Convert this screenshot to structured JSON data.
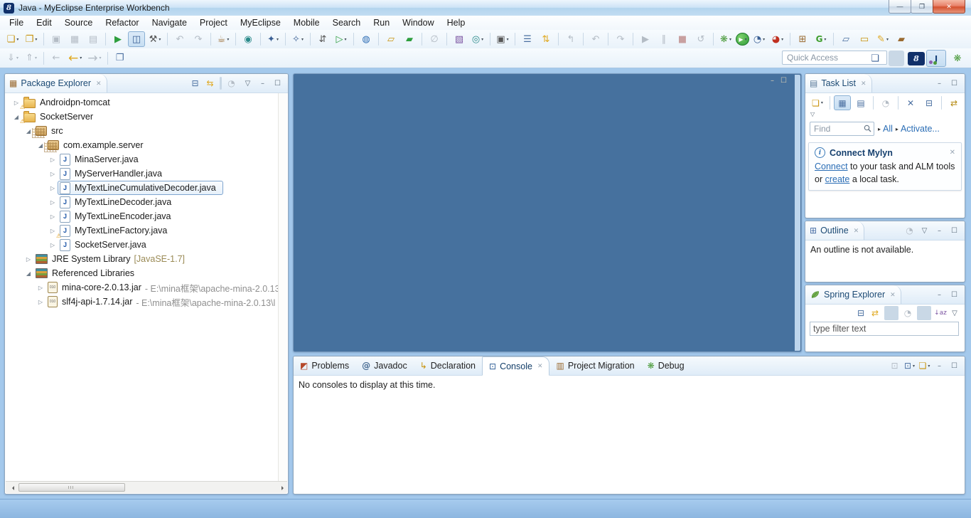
{
  "colors": {
    "titlebar": "#cde3f6",
    "workbench_bg": "#a4c9ec",
    "editor_bg": "#46719e",
    "link": "#2a6db5",
    "tab_text": "#1c4a74",
    "close_button": "#d4512f",
    "suffix_olive": "#9a8a55",
    "suffix_gray": "#8f8f8f"
  },
  "window": {
    "title": "Java - MyEclipse Enterprise Workbench",
    "logo": "8",
    "controls": [
      {
        "name": "minimize-button",
        "g": "—",
        "cls": "win"
      },
      {
        "name": "restore-button",
        "g": "❐",
        "cls": "win"
      },
      {
        "name": "close-button",
        "g": "✕",
        "cls": "close"
      }
    ]
  },
  "menu": {
    "items": [
      {
        "name": "menu-file",
        "label": "File"
      },
      {
        "name": "menu-edit",
        "label": "Edit"
      },
      {
        "name": "menu-source",
        "label": "Source"
      },
      {
        "name": "menu-refactor",
        "label": "Refactor"
      },
      {
        "name": "menu-navigate",
        "label": "Navigate"
      },
      {
        "name": "menu-project",
        "label": "Project"
      },
      {
        "name": "menu-myeclipse",
        "label": "MyEclipse"
      },
      {
        "name": "menu-mobile",
        "label": "Mobile"
      },
      {
        "name": "menu-search",
        "label": "Search"
      },
      {
        "name": "menu-run",
        "label": "Run"
      },
      {
        "name": "menu-window",
        "label": "Window"
      },
      {
        "name": "menu-help",
        "label": "Help"
      }
    ]
  },
  "toolbar1": {
    "items": [
      {
        "name": "new-wizard-icon",
        "g": "❏",
        "cls": "gold dd"
      },
      {
        "name": "new-web-project-icon",
        "g": "❐",
        "cls": "gold dd"
      },
      {
        "cls": "sep",
        "inter": false
      },
      {
        "name": "save-icon",
        "g": "▣",
        "cls": "dis"
      },
      {
        "name": "save-all-icon",
        "g": "▦",
        "cls": "dis"
      },
      {
        "name": "print-icon",
        "g": "▤",
        "cls": "dis"
      },
      {
        "cls": "sep",
        "inter": false
      },
      {
        "name": "run-on-device-icon",
        "g": "▶",
        "cls": "green"
      },
      {
        "name": "deploy-device-icon",
        "g": "◫",
        "cls": "navy press"
      },
      {
        "name": "build-hammer-icon",
        "g": "⚒",
        "cls": "dark dd"
      },
      {
        "cls": "sep",
        "inter": false
      },
      {
        "name": "previous-annotation-icon",
        "g": "↶",
        "cls": "dis"
      },
      {
        "name": "next-annotation-icon",
        "g": "↷",
        "cls": "dis"
      },
      {
        "cls": "sep",
        "inter": false
      },
      {
        "name": "new-javaee-component-icon",
        "g": "☕",
        "cls": "brown dd"
      },
      {
        "cls": "sep",
        "inter": false
      },
      {
        "name": "web20-icon",
        "g": "◉",
        "cls": "teal"
      },
      {
        "cls": "sep",
        "inter": false
      },
      {
        "name": "myeclipse-wizard-icon",
        "g": "✦",
        "cls": "navy dd"
      },
      {
        "cls": "sep",
        "inter": false
      },
      {
        "name": "myeclipse-deploy-wizard-icon",
        "g": "✧",
        "cls": "navy dd"
      },
      {
        "cls": "sep",
        "inter": false
      },
      {
        "name": "jar-sync-icon",
        "g": "⇵",
        "cls": "dark"
      },
      {
        "name": "run-external-tools-icon",
        "g": "▷",
        "cls": "green dd"
      },
      {
        "cls": "sep",
        "inter": false
      },
      {
        "name": "web-browser-icon",
        "g": "◍",
        "cls": "blue"
      },
      {
        "cls": "sep",
        "inter": false
      },
      {
        "name": "open-folder-icon",
        "g": "▱",
        "cls": "gold"
      },
      {
        "name": "sync-folder-icon",
        "g": "▰",
        "cls": "green"
      },
      {
        "cls": "sep",
        "inter": false
      },
      {
        "name": "toggle-disabled-icon",
        "g": "∅",
        "cls": "dis"
      },
      {
        "cls": "sep",
        "inter": false
      },
      {
        "name": "new-report-icon",
        "g": "▧",
        "cls": "purple"
      },
      {
        "name": "web-service-icon",
        "g": "◎",
        "cls": "teal dd"
      },
      {
        "cls": "sep",
        "inter": false
      },
      {
        "name": "screen-capture-icon",
        "g": "▣",
        "cls": "dark dd"
      },
      {
        "cls": "sep",
        "inter": false
      },
      {
        "name": "show-tasks-icon",
        "g": "☰",
        "cls": "steel"
      },
      {
        "name": "toggle-sort-icon",
        "g": "⇅",
        "cls": "goldarrow"
      },
      {
        "cls": "sep",
        "inter": false
      },
      {
        "name": "step-return-icon",
        "g": "↰",
        "cls": "dis"
      },
      {
        "cls": "sep",
        "inter": false
      },
      {
        "name": "undo-icon",
        "g": "↶",
        "cls": "dis"
      },
      {
        "cls": "sep",
        "inter": false
      },
      {
        "name": "redo-icon",
        "g": "↷",
        "cls": "dis"
      },
      {
        "cls": "sep",
        "inter": false
      },
      {
        "name": "resume-icon",
        "g": "▶",
        "cls": "dis"
      },
      {
        "name": "pause-icon",
        "g": "∥",
        "cls": "dis"
      },
      {
        "name": "terminate-icon",
        "g": "■",
        "cls": "disred"
      },
      {
        "name": "relaunch-icon",
        "g": "↺",
        "cls": "dis"
      },
      {
        "cls": "sep",
        "inter": false
      },
      {
        "name": "debug-icon",
        "g": "❋",
        "cls": "green2 dd"
      },
      {
        "name": "run-icon",
        "g": "▶",
        "cls": "circ dd"
      },
      {
        "name": "run-history-icon",
        "g": "◔",
        "cls": "navy dd"
      },
      {
        "name": "profile-icon",
        "g": "◕",
        "cls": "red dd"
      },
      {
        "cls": "sep",
        "inter": false
      },
      {
        "name": "junit-icon",
        "g": "⊞",
        "cls": "brown"
      },
      {
        "name": "generate-icon",
        "g": "G",
        "cls": "greenG dd"
      },
      {
        "cls": "sep",
        "inter": false
      },
      {
        "name": "open-resource-icon",
        "g": "▱",
        "cls": "steel"
      },
      {
        "name": "clipboard-folder-icon",
        "g": "▭",
        "cls": "gold"
      },
      {
        "name": "marker-pen-icon",
        "g": "✎",
        "cls": "goldarrow dd"
      },
      {
        "name": "open-type-icon",
        "g": "▰",
        "cls": "brown"
      }
    ]
  },
  "toolbar2": {
    "items": [
      {
        "name": "commit-icon",
        "g": "⇓",
        "cls": "dis dd"
      },
      {
        "name": "update-icon",
        "g": "⇑",
        "cls": "dis dd"
      },
      {
        "cls": "sep",
        "inter": false
      },
      {
        "name": "last-edit-location-icon",
        "g": "←",
        "cls": "dis"
      },
      {
        "name": "back-icon",
        "g": "←",
        "cls": "goldarrow big dd"
      },
      {
        "name": "forward-icon",
        "g": "→",
        "cls": "dis big dd"
      },
      {
        "cls": "sep",
        "inter": false
      },
      {
        "name": "link-with-editor-icon",
        "g": "❐",
        "cls": "steel"
      }
    ]
  },
  "quick_access": {
    "placeholder": "Quick Access"
  },
  "perspectives": {
    "items": [
      {
        "name": "open-perspective-icon",
        "g": "❏",
        "cls": "navy"
      },
      {
        "cls": "sep",
        "inter": false
      },
      {
        "name": "myeclipse-perspective-icon",
        "g": "8",
        "cls": "melogo"
      },
      {
        "name": "java-perspective-icon",
        "g": "J",
        "cls": "javapersp press"
      },
      {
        "name": "debug-perspective-icon",
        "g": "❋",
        "cls": "green2"
      }
    ]
  },
  "package_explorer": {
    "tab": {
      "label": "Package Explorer",
      "g": "▦",
      "close": "✕"
    },
    "toolbar": [
      {
        "name": "collapse-all-icon",
        "g": "⊟",
        "cls": "steel"
      },
      {
        "name": "link-with-editor-icon",
        "g": "⇆",
        "cls": "goldarrow"
      },
      {
        "cls": "sep",
        "inter": false
      },
      {
        "name": "focus-on-task-icon",
        "g": "◔",
        "cls": "dis"
      },
      {
        "cls": "spacer",
        "inter": false
      },
      {
        "name": "view-menu-icon",
        "g": "▽",
        "cls": "mini"
      },
      {
        "name": "minimize-icon",
        "g": "–",
        "cls": "mini"
      },
      {
        "name": "maximize-icon",
        "g": "☐",
        "cls": "mini"
      }
    ],
    "tree": [
      {
        "cls": "lv0",
        "arrow": "▷",
        "icon": "tomcat-project-icon",
        "icls": "i-folder warn",
        "label": "Androidpn-tomcat"
      },
      {
        "cls": "lv0",
        "arrow": "◢",
        "icon": "java-project-icon",
        "icls": "i-folder warn",
        "label": "SocketServer"
      },
      {
        "cls": "lv1",
        "arrow": "◢",
        "icon": "source-folder-icon",
        "icls": "i-src warn",
        "label": "src"
      },
      {
        "cls": "lv2",
        "arrow": "◢",
        "icon": "package-icon",
        "icls": "i-pkg warn",
        "label": "com.example.server"
      },
      {
        "cls": "lv3",
        "arrow": "▷",
        "icon": "java-file-icon",
        "icls": "i-java",
        "label": "MinaServer.java"
      },
      {
        "cls": "lv3",
        "arrow": "▷",
        "icon": "java-file-icon",
        "icls": "i-java",
        "label": "MyServerHandler.java"
      },
      {
        "cls": "lv3 sel",
        "arrow": "▷",
        "icon": "java-file-icon",
        "icls": "i-java",
        "label": "MyTextLineCumulativeDecoder.java"
      },
      {
        "cls": "lv3",
        "arrow": "▷",
        "icon": "java-file-icon",
        "icls": "i-java",
        "label": "MyTextLineDecoder.java"
      },
      {
        "cls": "lv3",
        "arrow": "▷",
        "icon": "java-file-icon",
        "icls": "i-java",
        "label": "MyTextLineEncoder.java"
      },
      {
        "cls": "lv3",
        "arrow": "▷",
        "icon": "java-file-icon",
        "icls": "i-java warn",
        "label": "MyTextLineFactory.java"
      },
      {
        "cls": "lv3",
        "arrow": "▷",
        "icon": "java-file-icon",
        "icls": "i-java",
        "label": "SocketServer.java"
      },
      {
        "cls": "lv1",
        "arrow": "▷",
        "icon": "library-icon",
        "icls": "i-lib",
        "label": "JRE System Library",
        "suffix": "[JavaSE-1.7]",
        "sufcls": "olive"
      },
      {
        "cls": "lv1",
        "arrow": "◢",
        "icon": "library-icon",
        "icls": "i-lib",
        "label": "Referenced Libraries"
      },
      {
        "cls": "lv2",
        "arrow": "▷",
        "icon": "jar-icon",
        "icls": "i-jar",
        "label": "mina-core-2.0.13.jar",
        "suffix": "- E:\\mina框架\\apache-mina-2.0.13",
        "sufcls": "gray"
      },
      {
        "cls": "lv2",
        "arrow": "▷",
        "icon": "jar-icon",
        "icls": "i-jar",
        "label": "slf4j-api-1.7.14.jar",
        "suffix": "- E:\\mina框架\\apache-mina-2.0.13\\l",
        "sufcls": "gray"
      }
    ]
  },
  "editor_area": {
    "icons": [
      {
        "name": "minimize-icon",
        "g": "–"
      },
      {
        "name": "maximize-icon",
        "g": "☐"
      }
    ]
  },
  "task_list": {
    "tab": {
      "label": "Task List",
      "g": "▤",
      "close": "✕"
    },
    "header_icons": [
      {
        "name": "minimize-icon",
        "g": "–",
        "cls": "mini"
      },
      {
        "name": "maximize-icon",
        "g": "☐",
        "cls": "mini"
      }
    ],
    "toolbar": [
      {
        "name": "new-task-icon",
        "g": "❏",
        "cls": "gold dd"
      },
      {
        "cls": "sep",
        "inter": false
      },
      {
        "name": "categorized-view-icon",
        "g": "▦",
        "cls": "steel press"
      },
      {
        "name": "scheduled-view-icon",
        "g": "▤",
        "cls": "steel"
      },
      {
        "cls": "sep",
        "inter": false
      },
      {
        "name": "focus-on-workweek-icon",
        "g": "◔",
        "cls": "dis"
      },
      {
        "cls": "sep",
        "inter": false
      },
      {
        "name": "hide-completed-icon",
        "g": "✕",
        "cls": "steel"
      },
      {
        "name": "collapse-all-icon",
        "g": "⊟",
        "cls": "steel"
      },
      {
        "cls": "sep",
        "inter": false
      },
      {
        "name": "synchronize-icon",
        "g": "⇄",
        "cls": "goldnavy"
      }
    ],
    "chevron": "▽",
    "find": {
      "placeholder": "Find"
    },
    "links": [
      {
        "name": "tasklist-filter-all",
        "arrow": "▸",
        "label": "All"
      },
      {
        "name": "tasklist-activate",
        "arrow": "▸",
        "label": "Activate..."
      }
    ],
    "mylyn": {
      "title": "Connect Mylyn",
      "close": "✕",
      "segments": [
        {
          "text": "Connect",
          "cls": "link",
          "inter": true
        },
        {
          "text": " to your task and ALM tools or ",
          "inter": false
        },
        {
          "text": "create",
          "cls": "link",
          "inter": true
        },
        {
          "text": " a local task.",
          "inter": false
        }
      ]
    }
  },
  "outline": {
    "tab": {
      "label": "Outline",
      "g": "⊞",
      "close": "✕"
    },
    "toolbar": [
      {
        "name": "focus-on-task-icon",
        "g": "◔",
        "cls": "dis"
      },
      {
        "name": "view-menu-icon",
        "g": "▽",
        "cls": "mini"
      },
      {
        "name": "minimize-icon",
        "g": "–",
        "cls": "mini"
      },
      {
        "name": "maximize-icon",
        "g": "☐",
        "cls": "mini"
      }
    ],
    "message": "An outline is not available."
  },
  "spring_explorer": {
    "tab": {
      "label": "Spring Explorer",
      "close": "✕"
    },
    "header_icons": [
      {
        "name": "minimize-icon",
        "g": "–",
        "cls": "mini"
      },
      {
        "name": "maximize-icon",
        "g": "☐",
        "cls": "mini"
      }
    ],
    "toolbar": [
      {
        "name": "collapse-all-icon",
        "g": "⊟",
        "cls": "steel"
      },
      {
        "name": "link-with-editor-icon",
        "g": "⇄",
        "cls": "goldarrow"
      },
      {
        "cls": "sep",
        "inter": false
      },
      {
        "name": "focus-on-task-icon",
        "g": "◔",
        "cls": "dis"
      },
      {
        "cls": "sep",
        "inter": false
      },
      {
        "name": "sort-icon",
        "g": "↓az",
        "cls": "sortaz"
      },
      {
        "name": "view-menu-icon",
        "g": "▽",
        "cls": "mini"
      }
    ],
    "filter": {
      "placeholder": "type filter text"
    }
  },
  "console_panel": {
    "tabs": [
      {
        "name": "tab-problems",
        "icon": "problems-icon",
        "g": "◩",
        "icls": "ic-problems",
        "label": "Problems"
      },
      {
        "name": "tab-javadoc",
        "icon": "javadoc-icon",
        "g": "@",
        "icls": "ic-at",
        "label": "Javadoc"
      },
      {
        "name": "tab-declaration",
        "icon": "declaration-icon",
        "g": "↳",
        "icls": "ic-decl",
        "label": "Declaration"
      },
      {
        "name": "tab-console",
        "icon": "console-icon",
        "g": "⊡",
        "icls": "ic-console",
        "label": "Console",
        "cls": "active",
        "close": "✕"
      },
      {
        "name": "tab-project-migration",
        "icon": "project-migration-icon",
        "g": "▥",
        "icls": "ic-migr",
        "label": "Project Migration"
      },
      {
        "name": "tab-debug",
        "icon": "debug-icon",
        "g": "❋",
        "icls": "ic-debug",
        "label": "Debug"
      }
    ],
    "toolbar": [
      {
        "name": "pin-console-icon",
        "g": "⊡",
        "cls": "dis"
      },
      {
        "name": "display-console-icon",
        "g": "⊡",
        "cls": "steel dd"
      },
      {
        "name": "open-console-icon",
        "g": "❏",
        "cls": "gold dd"
      },
      {
        "name": "minimize-icon",
        "g": "–",
        "cls": "mini"
      },
      {
        "name": "maximize-icon",
        "g": "☐",
        "cls": "mini"
      }
    ],
    "message": "No consoles to display at this time."
  }
}
